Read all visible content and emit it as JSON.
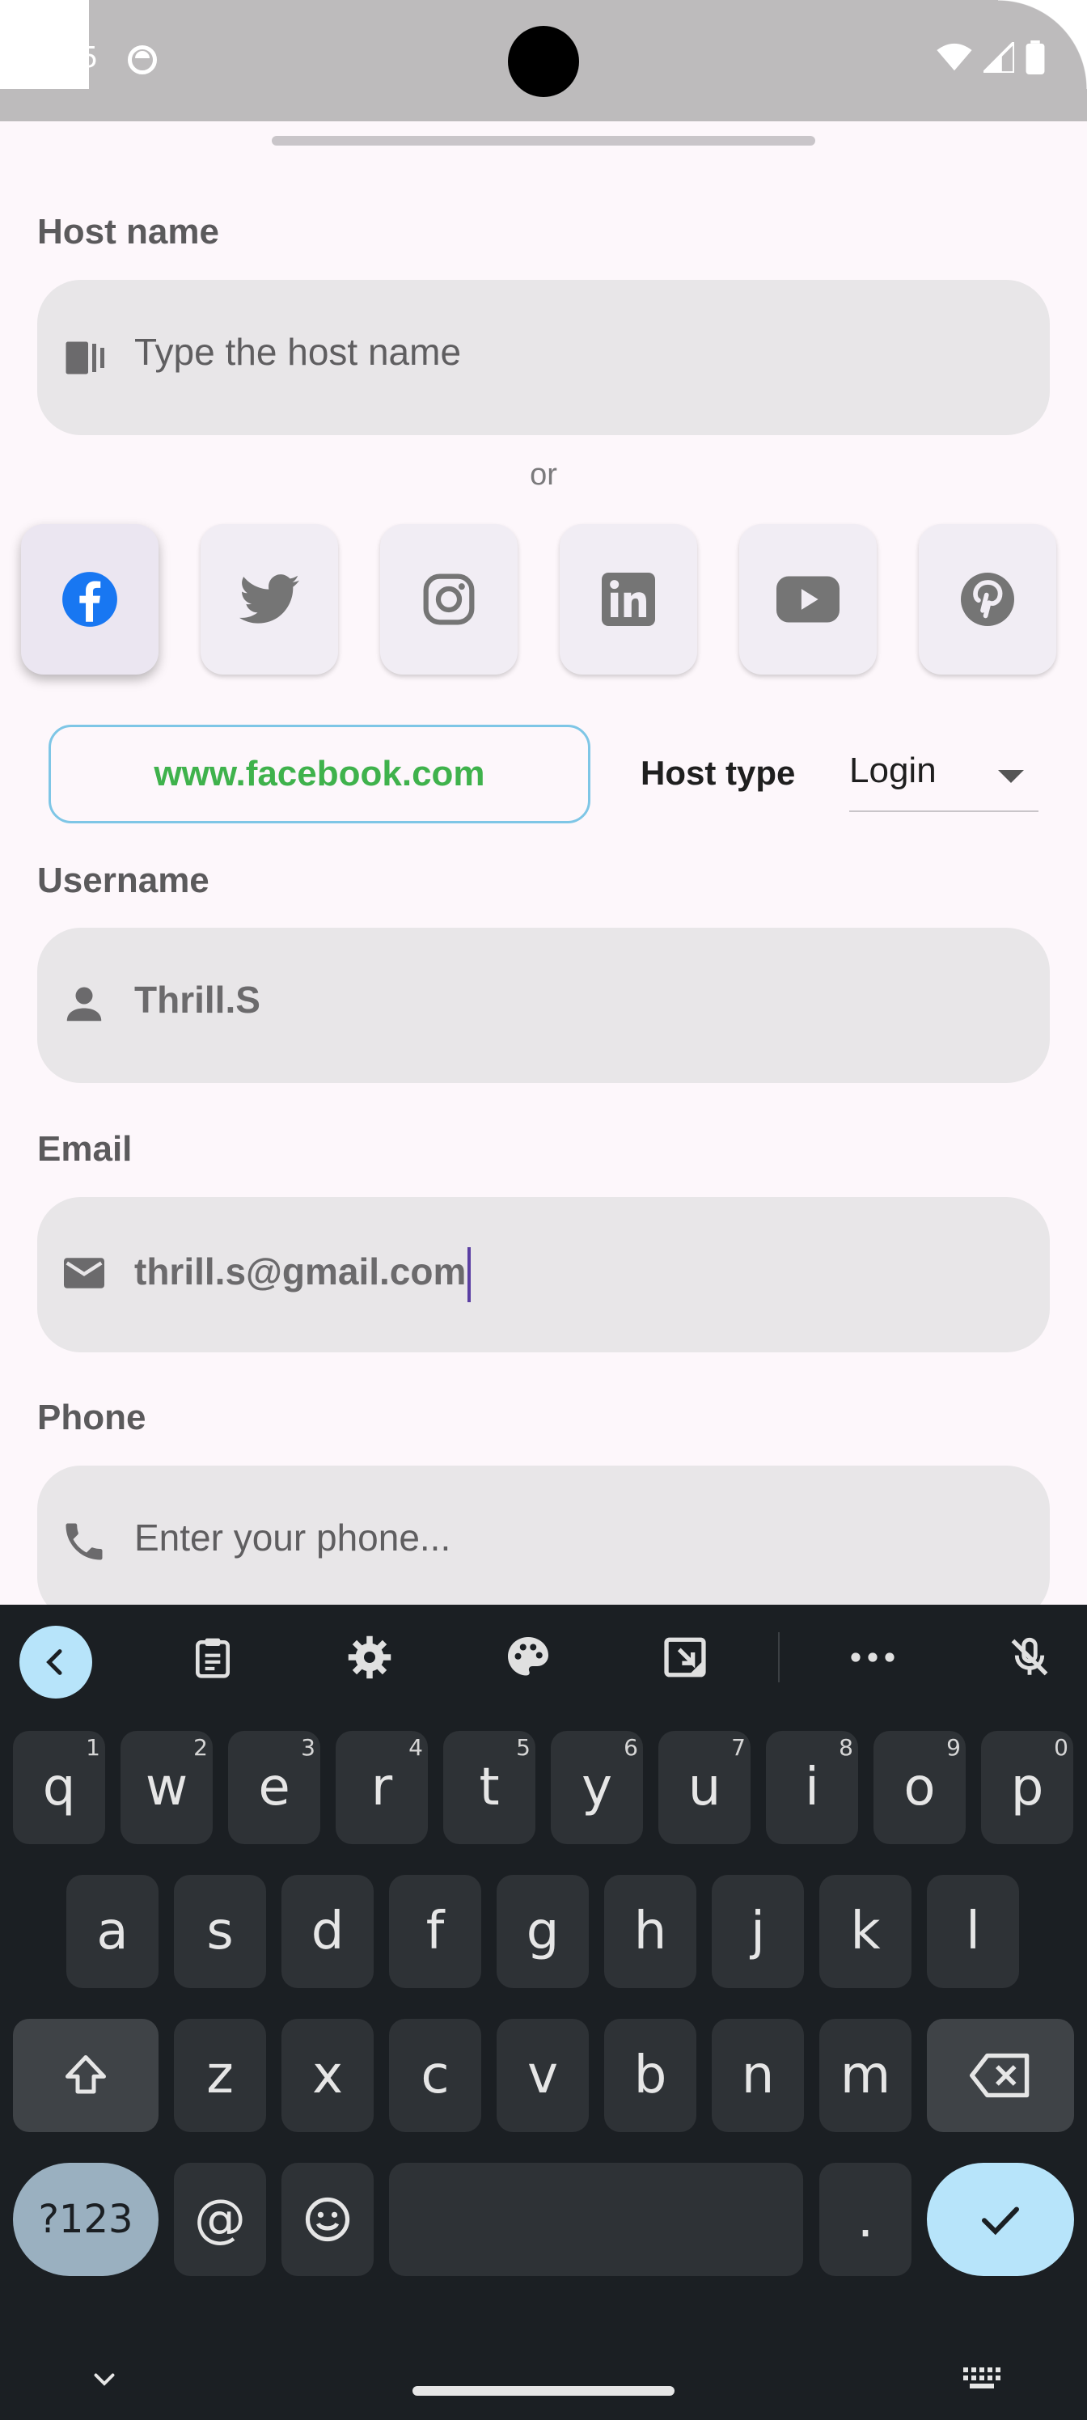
{
  "status_bar": {
    "time": "9:35"
  },
  "form": {
    "host_name": {
      "label": "Host name",
      "placeholder": "Type the host name",
      "icon": "host-icon"
    },
    "or_text": "or",
    "social_hosts": [
      {
        "name": "facebook",
        "icon": "facebook-icon",
        "selected": true,
        "color": "#1877F2"
      },
      {
        "name": "twitter",
        "icon": "twitter-icon",
        "selected": false,
        "color": "#757575"
      },
      {
        "name": "instagram",
        "icon": "instagram-icon",
        "selected": false,
        "color": "#757575"
      },
      {
        "name": "linkedin",
        "icon": "linkedin-icon",
        "selected": false,
        "color": "#757575"
      },
      {
        "name": "youtube",
        "icon": "youtube-icon",
        "selected": false,
        "color": "#757575"
      },
      {
        "name": "pinterest",
        "icon": "pinterest-icon",
        "selected": false,
        "color": "#757575"
      }
    ],
    "host_url": "www.facebook.com",
    "host_type": {
      "label": "Host type",
      "value": "Login"
    },
    "username": {
      "label": "Username",
      "value": "Thrill.S",
      "icon": "person-icon"
    },
    "email": {
      "label": "Email",
      "value": "thrill.s@gmail.com",
      "icon": "email-icon"
    },
    "phone": {
      "label": "Phone",
      "placeholder": "Enter your phone...",
      "icon": "phone-icon"
    }
  },
  "keyboard": {
    "row1": [
      {
        "key": "q",
        "hint": "1"
      },
      {
        "key": "w",
        "hint": "2"
      },
      {
        "key": "e",
        "hint": "3"
      },
      {
        "key": "r",
        "hint": "4"
      },
      {
        "key": "t",
        "hint": "5"
      },
      {
        "key": "y",
        "hint": "6"
      },
      {
        "key": "u",
        "hint": "7"
      },
      {
        "key": "i",
        "hint": "8"
      },
      {
        "key": "o",
        "hint": "9"
      },
      {
        "key": "p",
        "hint": "0"
      }
    ],
    "row2": [
      "a",
      "s",
      "d",
      "f",
      "g",
      "h",
      "j",
      "k",
      "l"
    ],
    "row3": [
      "z",
      "x",
      "c",
      "v",
      "b",
      "n",
      "m"
    ],
    "sym_label": "?123",
    "at_label": "@",
    "period_label": "."
  },
  "colors": {
    "accent_green": "#3fb24c",
    "accent_blue": "#7ec6e6",
    "keyboard_bg": "#1b1f23"
  }
}
